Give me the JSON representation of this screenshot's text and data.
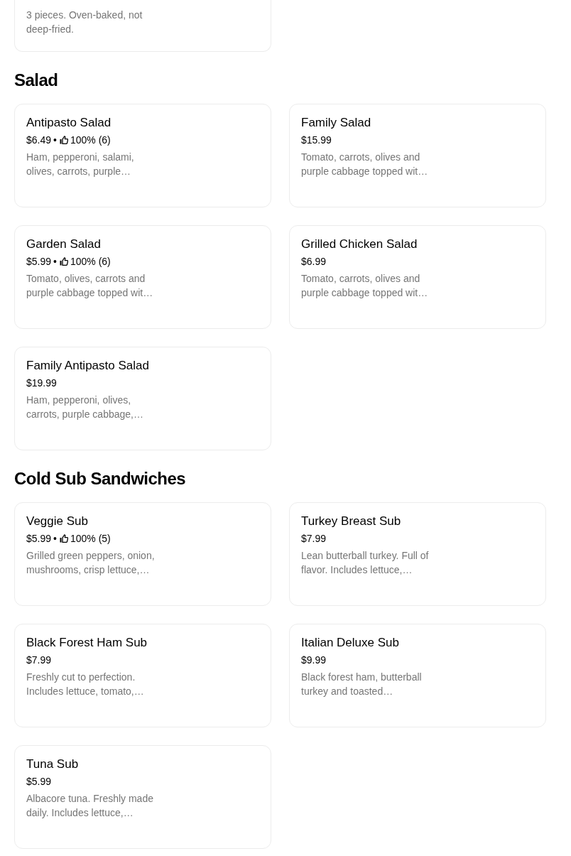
{
  "top_card": {
    "description": "3 pieces. Oven-baked, not deep-fried."
  },
  "sections": [
    {
      "title": "Salad",
      "items": [
        {
          "name": "Antipasto Salad",
          "price": "$6.49",
          "separator": "•",
          "rating": "100% (6)",
          "description": "Ham, pepperoni, salami, olives, carrots, purple…"
        },
        {
          "name": "Family Salad",
          "price": "$15.99",
          "description": "Tomato, carrots, olives and purple cabbage topped wit…"
        },
        {
          "name": "Garden Salad",
          "price": "$5.99",
          "separator": "•",
          "rating": "100% (6)",
          "description": "Tomato, olives, carrots and purple cabbage topped wit…"
        },
        {
          "name": "Grilled Chicken Salad",
          "price": "$6.99",
          "description": "Tomato, carrots, olives and purple cabbage topped wit…"
        },
        {
          "name": "Family Antipasto Salad",
          "price": "$19.99",
          "description": "Ham, pepperoni, olives, carrots, purple cabbage,…"
        }
      ]
    },
    {
      "title": "Cold Sub Sandwiches",
      "items": [
        {
          "name": "Veggie Sub",
          "price": "$5.99",
          "separator": "•",
          "rating": "100% (5)",
          "description": "Grilled green peppers, onion, mushrooms, crisp lettuce,…"
        },
        {
          "name": "Turkey Breast Sub",
          "price": "$7.99",
          "description": "Lean butterball turkey. Full of flavor. Includes lettuce,…"
        },
        {
          "name": "Black Forest Ham Sub",
          "price": "$7.99",
          "description": "Freshly cut to perfection. Includes lettuce, tomato,…"
        },
        {
          "name": "Italian Deluxe Sub",
          "price": "$9.99",
          "description": "Black forest ham, butterball turkey and toasted…"
        },
        {
          "name": "Tuna Sub",
          "price": "$5.99",
          "description": "Albacore tuna. Freshly made daily. Includes lettuce,…"
        }
      ]
    }
  ]
}
